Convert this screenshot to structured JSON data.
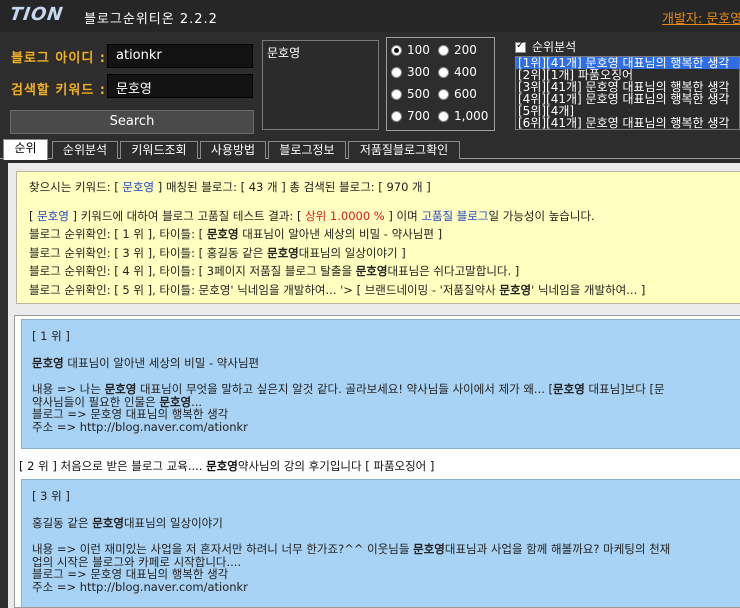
{
  "titlebar": {
    "logo": "TION",
    "title": "블로그순위티온 2.2.2",
    "developer": "개발자: 문호영"
  },
  "search": {
    "blog_id_label": "블로그 아이디 :",
    "blog_id_value": "ationkr",
    "keyword_label": "검색할 키워드 :",
    "keyword_value": "문호영",
    "button": "Search"
  },
  "keyword_list": [
    "문호영"
  ],
  "radios": [
    {
      "label": "100",
      "checked": true
    },
    {
      "label": "200",
      "checked": false
    },
    {
      "label": "300",
      "checked": false
    },
    {
      "label": "400",
      "checked": false
    },
    {
      "label": "500",
      "checked": false
    },
    {
      "label": "600",
      "checked": false
    },
    {
      "label": "700",
      "checked": false
    },
    {
      "label": "1,000",
      "checked": false
    }
  ],
  "rank_check": {
    "label": "순위분석",
    "checked": true
  },
  "rank_list": [
    "[1위][41개] 문호영 대표님의 행복한 생각",
    "[2위][1개] 파품오징어",
    "[3위][41개] 문호영 대표님의 행복한 생각",
    "[4위][41개] 문호영 대표님의 행복한 생각",
    "[5위][4개]",
    "[6위][41개] 문호영 대표님의 행복한 생각"
  ],
  "tabs": [
    "순위",
    "순위분석",
    "키워드조회",
    "사용방법",
    "블로그정보",
    "저품질블로그확인"
  ],
  "summary": {
    "l1_a": "찾으시는 키워드: [ ",
    "l1_kw": "문호영",
    "l1_b": " ] 매칭된 블로그: [ 43 개 ] 총 검색된 블로그: [ 970 개 ]",
    "l2_a": "[ ",
    "l2_kw": "문호영",
    "l2_b": " ] 키워드에 대하여 블로그 고품질 테스트 결과: [ ",
    "l2_red": "상위 1.0000 %",
    "l2_c": " ] 이며 ",
    "l2_kw2": "고품질 블로그",
    "l2_d": "일 가능성이 높습니다.",
    "l3_a": "블로그 순위확인: [ 1 위 ], 타이틀: [ ",
    "l3_bold": "문호영",
    "l3_b": " 대표님이 알아낸 세상의 비밀 - 약사님편 ]",
    "l4_a": "블로그 순위확인: [ 3 위 ], 타이틀: [ 홍길동 같은 ",
    "l4_bold": "문호영",
    "l4_b": "대표님의 일상이야기 ]",
    "l5_a": "블로그 순위확인: [ 4 위 ], 타이틀: [ 3페이지 저품질 블로그 탈출을 ",
    "l5_bold": "문호영",
    "l5_b": "대표님은 쉬다고말합니다. ]",
    "l6_a": "블로그 순위확인: [ 5 위 ], 타이틀: 문호영' 닉네임을 개발하여... '> [ 브랜드네이밍 - '저품질약사 ",
    "l6_bold": "문호영",
    "l6_b": "' 닉네임을 개발하여... ]"
  },
  "results": {
    "card1": {
      "rank": "[ 1 위 ]",
      "title_bold": "문호영",
      "title_rest": " 대표님이 알아낸 세상의 비밀 - 약사님편",
      "content_a": "내용 => 나는 ",
      "content_bold": "문호영",
      "content_b": " 대표님이 무엇을 말하고 싶은지 알것 같다. 골라보세요! 약사님들 사이에서 제가 왜... [",
      "content_bold2": "문호영",
      "content_c": " 대표님]보다 [문",
      "content2_a": "약사님들이 필요한 인물은 ",
      "content2_bold": "문호영",
      "content2_b": "...",
      "blog": "블로그 => 문호영 대표님의 행복한 생각",
      "addr": "주소 => http://blog.naver.com/ationkr"
    },
    "plain2_a": "[ 2 위 ] 처음으로 받은 블로그 교육.... ",
    "plain2_bold": "문호영",
    "plain2_b": "약사님의 강의 후기입니다 [ 파품오징어 ]",
    "card3": {
      "rank": "[ 3 위 ]",
      "title_a": "홍길동 같은 ",
      "title_bold": "문호영",
      "title_rest": "대표님의 일상이야기",
      "content_a": "내용 => 이런 재미있는 사업을 저 혼자서만 하려니 너무 한가죠?^^ 이웃님들 ",
      "content_bold": "문호영",
      "content_b": "대표님과 사업을 함께 해볼까요? 마케팅의 천재 ",
      "content2": "업의 시작은 블로그와 카페로 시작합니다....",
      "blog": "블로그 => 문호영 대표님의 행복한 생각",
      "addr": "주소 => http://blog.naver.com/ationkr"
    }
  }
}
